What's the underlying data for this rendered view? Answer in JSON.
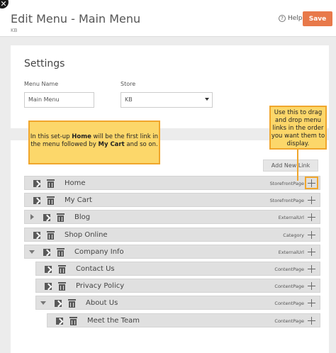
{
  "header": {
    "title": "Edit Menu - Main Menu",
    "subtitle": "KB",
    "help_label": "Help",
    "help_icon": "question-circle-icon",
    "save_label": "Save",
    "close_glyph": "✕"
  },
  "settings": {
    "title": "Settings",
    "menu_name_label": "Menu Name",
    "menu_name_value": "Main Menu",
    "store_label": "Store",
    "store_value": "KB"
  },
  "list": {
    "add_link_label": "Add New Link",
    "items": [
      {
        "name": "Home",
        "type": "StorefrontPage",
        "level": 0,
        "expander": "none"
      },
      {
        "name": "My Cart",
        "type": "StorefrontPage",
        "level": 0,
        "expander": "none"
      },
      {
        "name": "Blog",
        "type": "ExternalUrl",
        "level": 0,
        "expander": "collapsed"
      },
      {
        "name": "Shop Online",
        "type": "Category",
        "level": 0,
        "expander": "none"
      },
      {
        "name": "Company Info",
        "type": "ExternalUrl",
        "level": 0,
        "expander": "expanded"
      },
      {
        "name": "Contact Us",
        "type": "ContentPage",
        "level": 1,
        "expander": "none"
      },
      {
        "name": "Privacy Policy",
        "type": "ContentPage",
        "level": 1,
        "expander": "none"
      },
      {
        "name": "About Us",
        "type": "ContentPage",
        "level": 1,
        "expander": "expanded"
      },
      {
        "name": "Meet the Team",
        "type": "ContentPage",
        "level": 2,
        "expander": "none"
      }
    ]
  },
  "callouts": {
    "first": {
      "part1": "In this set-up ",
      "home": "Home",
      "part2": " will be the first link in the menu followed by ",
      "cart": "My Cart",
      "part3": "  and so on."
    },
    "drag_hint": "Use this to drag and drop menu links in the order you want them to display."
  },
  "colors": {
    "accent": "#e8794a",
    "callout_fill": "#fcd76a",
    "callout_border": "#f0a62c"
  }
}
